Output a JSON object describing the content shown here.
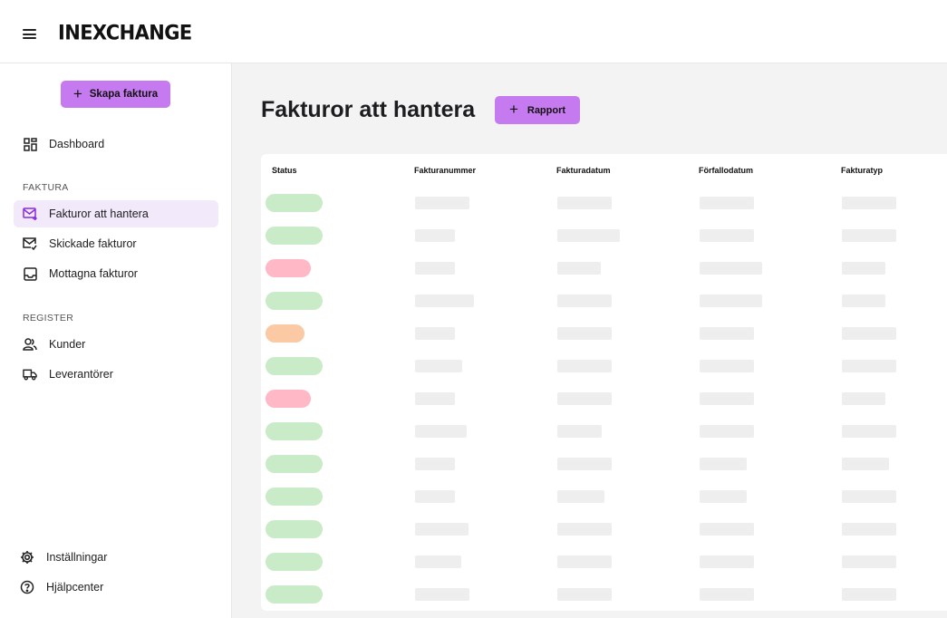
{
  "header": {
    "logo": "INEXCHANGE"
  },
  "sidebar": {
    "create_button": "Skapa faktura",
    "dashboard": "Dashboard",
    "section_faktura": "FAKTURA",
    "items_faktura": [
      {
        "label": "Fakturor att hantera",
        "icon": "mail-arrow-icon",
        "active": true
      },
      {
        "label": "Skickade fakturor",
        "icon": "mail-check-icon",
        "active": false
      },
      {
        "label": "Mottagna fakturor",
        "icon": "inbox-icon",
        "active": false
      }
    ],
    "section_register": "REGISTER",
    "items_register": [
      {
        "label": "Kunder",
        "icon": "users-icon"
      },
      {
        "label": "Leverantörer",
        "icon": "truck-icon"
      }
    ],
    "footer": [
      {
        "label": "Inställningar",
        "icon": "gear-icon"
      },
      {
        "label": "Hjälpcenter",
        "icon": "help-icon"
      }
    ]
  },
  "main": {
    "title": "Fakturor att hantera",
    "report_button": "Rapport",
    "columns": [
      "Status",
      "Fakturanummer",
      "Fakturadatum",
      "Förfallodatum",
      "Fakturatyp"
    ],
    "status_colors": {
      "green": "#c9ebc7",
      "red": "#ffb8c6",
      "orange": "#fbc9a4"
    },
    "accent": "#c67af0",
    "rows": [
      {
        "status": "green"
      },
      {
        "status": "green"
      },
      {
        "status": "red"
      },
      {
        "status": "green"
      },
      {
        "status": "orange"
      },
      {
        "status": "green"
      },
      {
        "status": "red"
      },
      {
        "status": "green"
      },
      {
        "status": "green"
      },
      {
        "status": "green"
      },
      {
        "status": "green"
      },
      {
        "status": "green"
      },
      {
        "status": "green"
      }
    ]
  }
}
